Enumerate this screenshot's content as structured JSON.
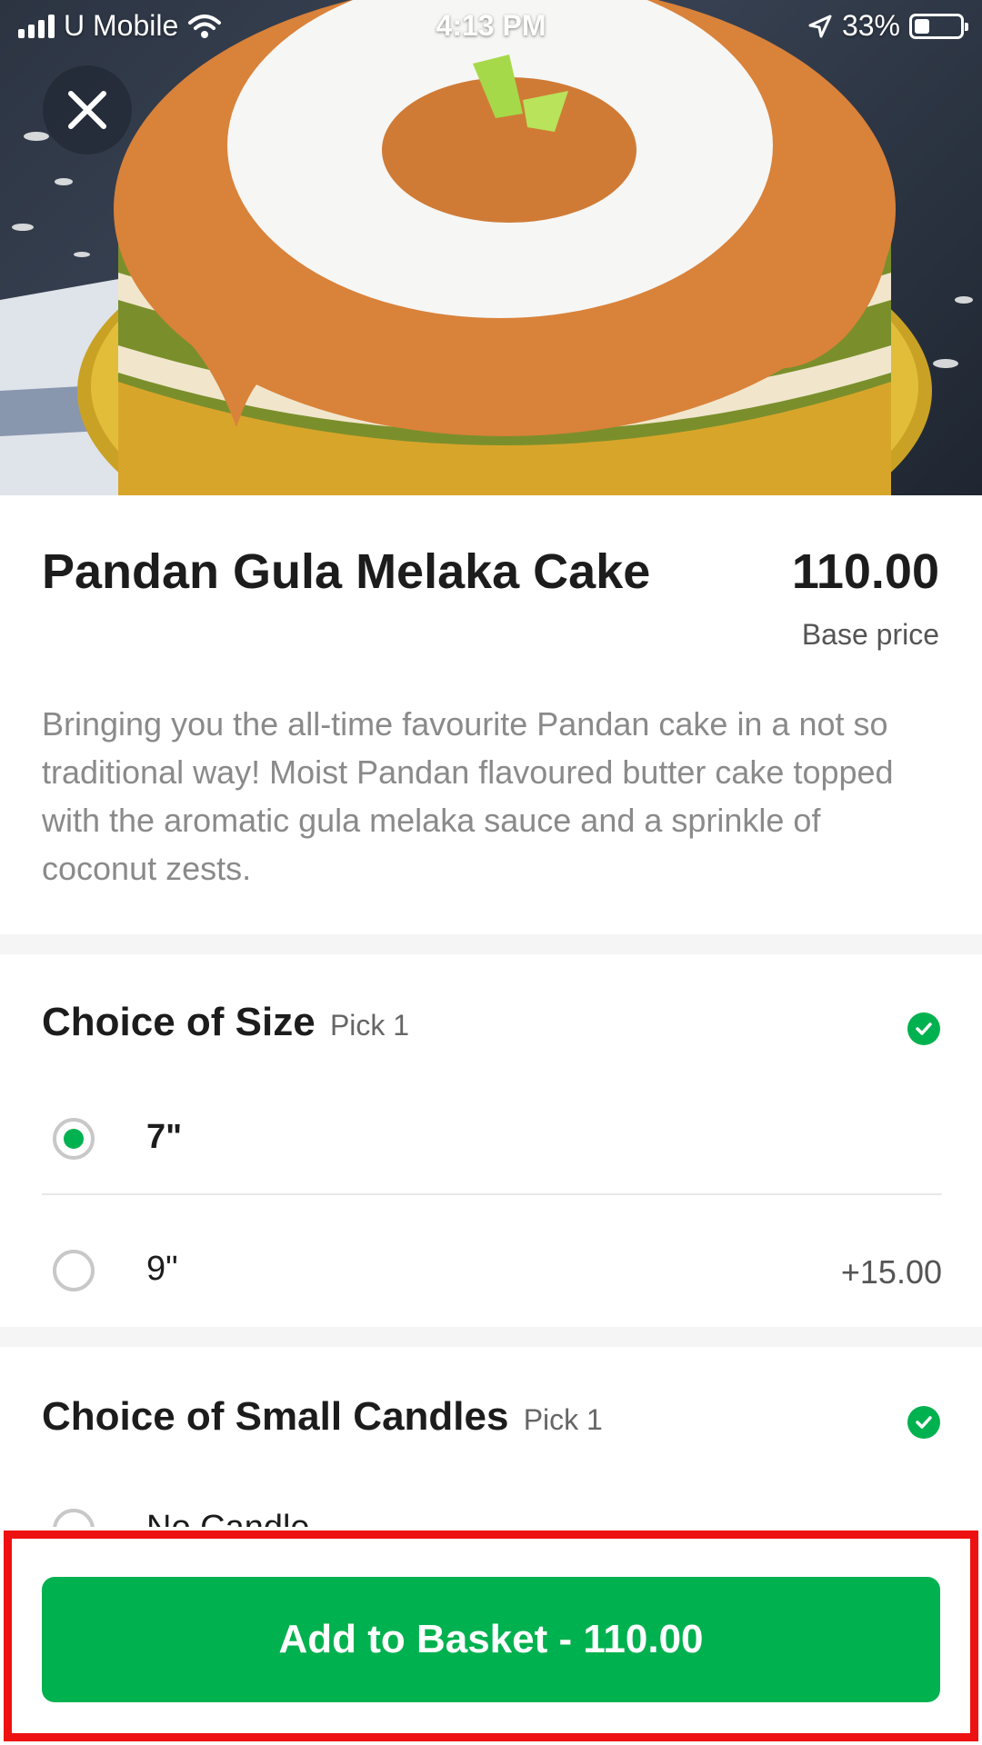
{
  "status_bar": {
    "carrier": "U Mobile",
    "time": "4:13 PM",
    "battery": "33%"
  },
  "hero": {
    "image_alt": "Pandan gula melaka cake topped with coconut flakes"
  },
  "product": {
    "title": "Pandan Gula Melaka Cake",
    "price": "110.00",
    "price_caption": "Base price",
    "description": "Bringing you the all-time favourite Pandan cake in a not so traditional way! Moist Pandan flavoured butter cake topped with the aromatic gula melaka sauce and a sprinkle of coconut zests."
  },
  "size_section": {
    "title": "Choice of Size",
    "pick": "Pick 1",
    "options": [
      {
        "label": "7\"",
        "extra": "",
        "selected": true
      },
      {
        "label": "9\"",
        "extra": "+15.00",
        "selected": false
      }
    ]
  },
  "candles_section": {
    "title": "Choice of Small Candles",
    "pick": "Pick 1",
    "options": [
      {
        "label": "No Candle",
        "extra": "",
        "selected": false
      }
    ]
  },
  "footer": {
    "add_button_label": "Add to Basket - 110.00"
  },
  "colors": {
    "accent_green": "#00b14f",
    "highlight_red": "#ee1111"
  },
  "icons": [
    "close-icon",
    "check-icon",
    "signal-icon",
    "wifi-icon",
    "location-arrow-icon",
    "battery-icon"
  ]
}
